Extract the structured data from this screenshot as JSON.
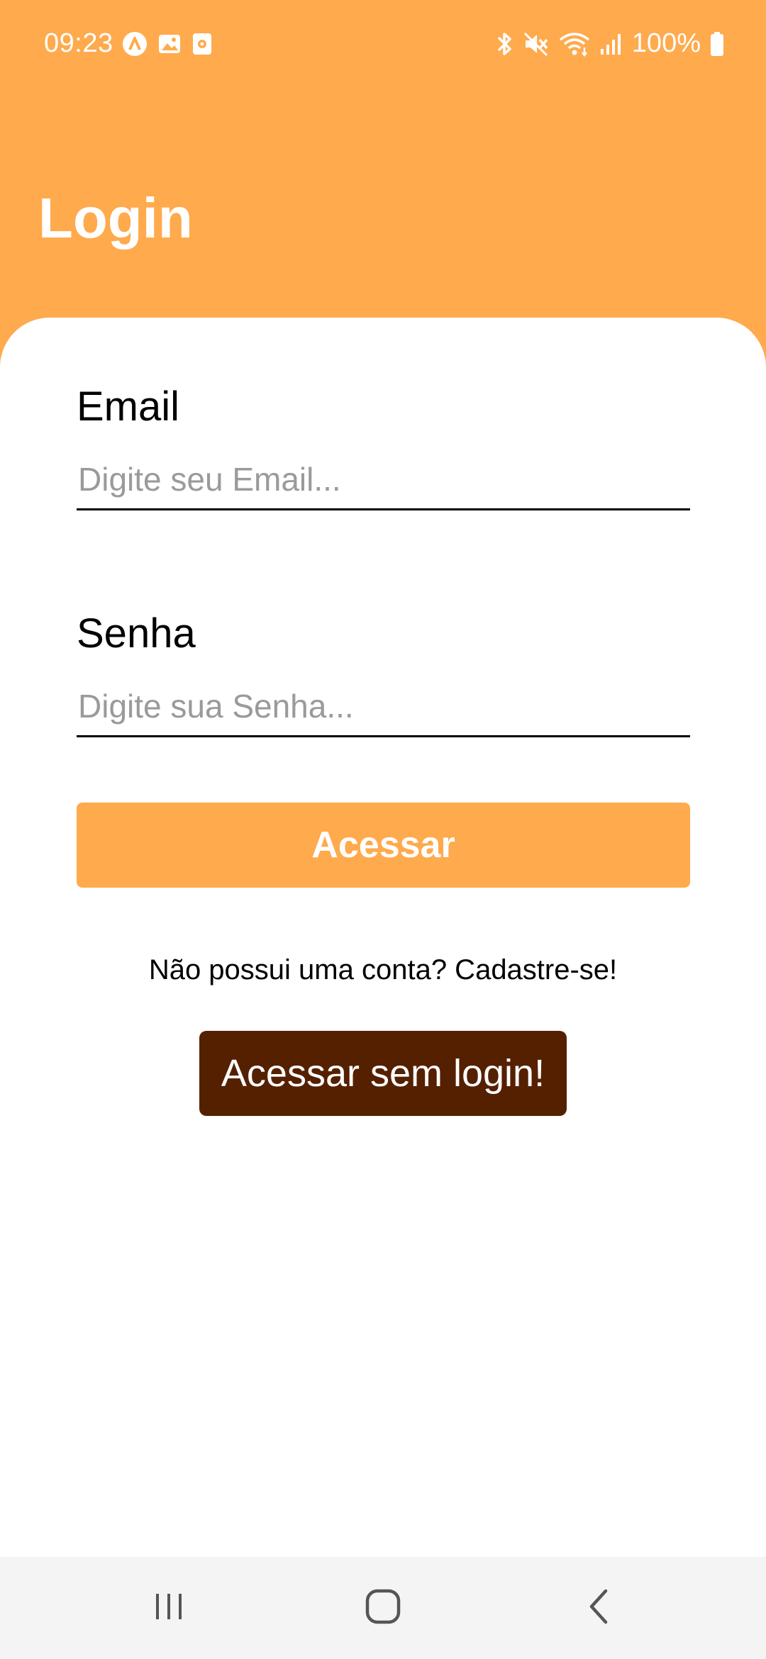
{
  "status_bar": {
    "time": "09:23",
    "battery_percent": "100%",
    "left_icons": [
      "app-a-icon",
      "image-icon",
      "screen-record-icon"
    ],
    "right_icons": [
      "bluetooth-icon",
      "mute-icon",
      "wifi-icon",
      "signal-icon",
      "battery-icon"
    ]
  },
  "header": {
    "title": "Login",
    "background_color": "#FFAA4D"
  },
  "form": {
    "email": {
      "label": "Email",
      "placeholder": "Digite seu Email...",
      "value": ""
    },
    "password": {
      "label": "Senha",
      "placeholder": "Digite sua Senha...",
      "value": ""
    },
    "submit_label": "Acessar",
    "signup_text": "Não possui uma conta? Cadastre-se!",
    "guest_label": "Acessar sem login!"
  },
  "colors": {
    "accent": "#FFAA4D",
    "guest_button": "#552000"
  },
  "nav_bar": {
    "icons": [
      "recent-apps-icon",
      "home-icon",
      "back-icon"
    ]
  }
}
